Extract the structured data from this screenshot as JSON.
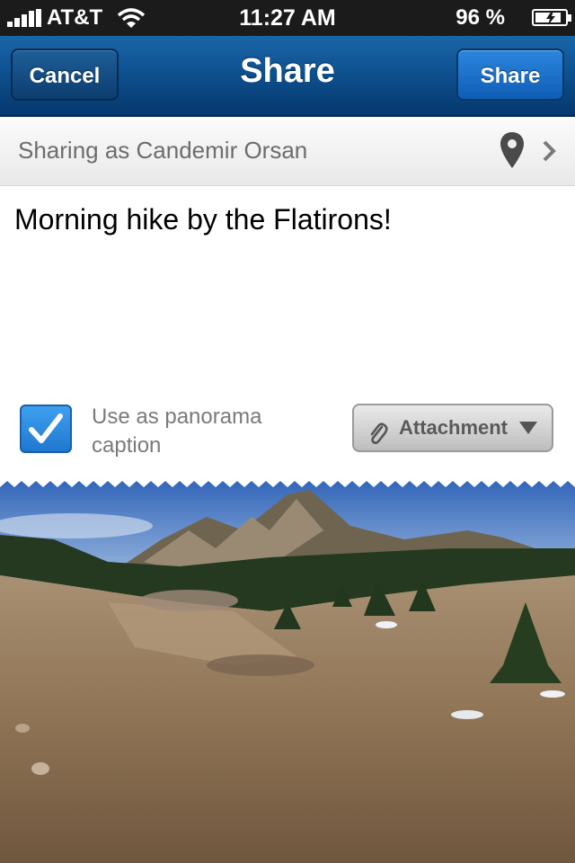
{
  "status_bar": {
    "carrier": "AT&T",
    "time": "11:27 AM",
    "battery": "96 %",
    "battery_level": 0.96
  },
  "nav": {
    "title": "Share",
    "cancel_label": "Cancel",
    "share_label": "Share"
  },
  "sharing": {
    "label": "Sharing as Candemir Orsan",
    "location_icon": "location-pin-icon",
    "disclosure_icon": "chevron-right-icon"
  },
  "message": {
    "text": "Morning hike by the Flatirons!"
  },
  "caption_option": {
    "checked": true,
    "label": "Use as panorama caption"
  },
  "attachment": {
    "label": "Attachment",
    "icon": "paperclip-icon"
  },
  "colors": {
    "nav_blue": "#0d4f8d",
    "share_button_blue": "#1f6fc8",
    "checkbox_blue": "#2a8ae0"
  }
}
